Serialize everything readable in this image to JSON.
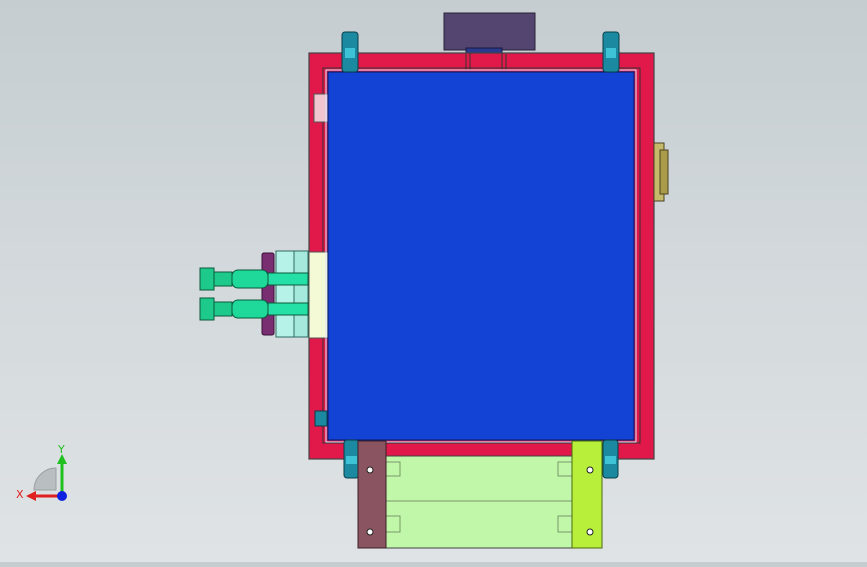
{
  "viewport": {
    "background_top": "#c5cdd1",
    "background_bottom": "#dfe3e5"
  },
  "model": {
    "frame_color": "#e0194a",
    "panel_color": "#1243d4",
    "bracket_color": "#1b8aa0",
    "fitting_color": "#1ec98c",
    "tray_color": "#c1f7a8",
    "left_rail_color": "#8a5560",
    "right_rail_color": "#b7ef3a",
    "top_block_color": "#534470",
    "clamp_color": "#7a2e72",
    "manifold_color": "#b7f2e8",
    "side_button_color": "#c7b96a"
  },
  "triad": {
    "x_label": "X",
    "y_label": "Y",
    "x_color": "#e02020",
    "y_color": "#20c020",
    "z_color": "#1020e0"
  }
}
